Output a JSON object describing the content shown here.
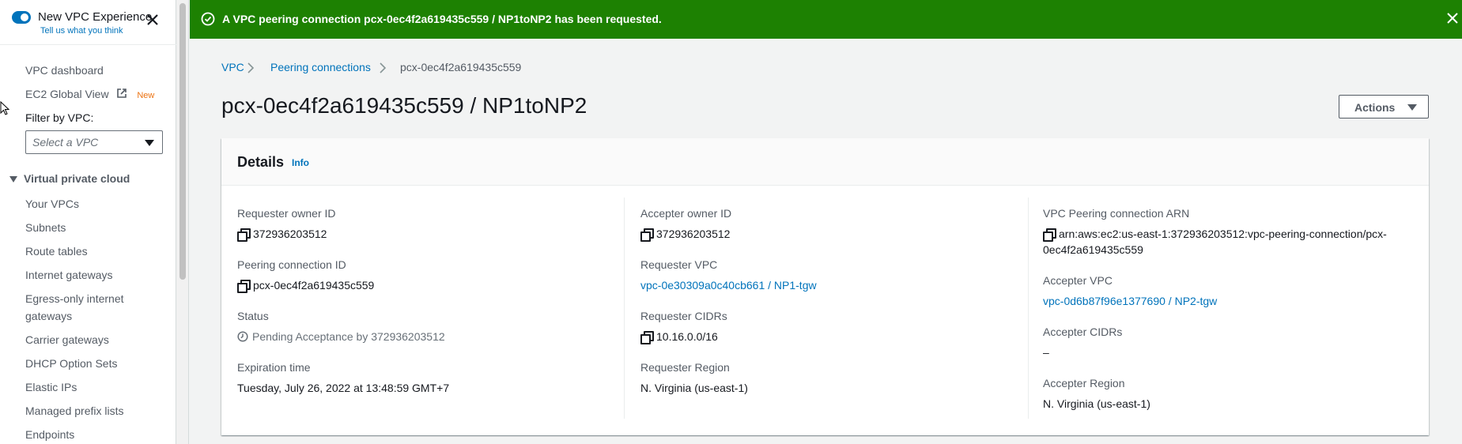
{
  "sidebar": {
    "experience_label": "New VPC Experience",
    "feedback_link": "Tell us what you think",
    "dashboard": "VPC dashboard",
    "ec2_global_view": "EC2 Global View",
    "new_badge": "New",
    "filter_label": "Filter by VPC:",
    "filter_placeholder": "Select a VPC",
    "section_title": "Virtual private cloud",
    "items": [
      {
        "label": "Your VPCs"
      },
      {
        "label": "Subnets"
      },
      {
        "label": "Route tables"
      },
      {
        "label": "Internet gateways"
      },
      {
        "label": "Egress-only internet gateways"
      },
      {
        "label": "Carrier gateways"
      },
      {
        "label": "DHCP Option Sets"
      },
      {
        "label": "Elastic IPs"
      },
      {
        "label": "Managed prefix lists"
      },
      {
        "label": "Endpoints"
      }
    ]
  },
  "flash": {
    "message": "A VPC peering connection pcx-0ec4f2a619435c559 / NP1toNP2 has been requested.",
    "color": "#1d8102"
  },
  "breadcrumb": {
    "items": [
      {
        "label": "VPC"
      },
      {
        "label": "Peering connections"
      },
      {
        "label": "pcx-0ec4f2a619435c559"
      }
    ]
  },
  "page": {
    "title": "pcx-0ec4f2a619435c559 / NP1toNP2",
    "actions_label": "Actions"
  },
  "details": {
    "title": "Details",
    "info_label": "Info",
    "requester_owner_id": {
      "label": "Requester owner ID",
      "value": "372936203512"
    },
    "peering_connection_id": {
      "label": "Peering connection ID",
      "value": "pcx-0ec4f2a619435c559"
    },
    "status": {
      "label": "Status",
      "value": "Pending Acceptance by 372936203512"
    },
    "expiration_time": {
      "label": "Expiration time",
      "value": "Tuesday, July 26, 2022 at 13:48:59 GMT+7"
    },
    "accepter_owner_id": {
      "label": "Accepter owner ID",
      "value": "372936203512"
    },
    "requester_vpc": {
      "label": "Requester VPC",
      "value": "vpc-0e30309a0c40cb661 / NP1-tgw"
    },
    "requester_cidrs": {
      "label": "Requester CIDRs",
      "value": "10.16.0.0/16"
    },
    "requester_region": {
      "label": "Requester Region",
      "value": "N. Virginia (us-east-1)"
    },
    "peering_arn": {
      "label": "VPC Peering connection ARN",
      "value_line1": "arn:aws:ec2:us-east-1:372936203512:vpc-peering-connection/pcx-",
      "value_line2": "0ec4f2a619435c559"
    },
    "accepter_vpc": {
      "label": "Accepter VPC",
      "value": "vpc-0d6b87f96e1377690 / NP2-tgw"
    },
    "accepter_cidrs": {
      "label": "Accepter CIDRs",
      "value": "–"
    },
    "accepter_region": {
      "label": "Accepter Region",
      "value": "N. Virginia (us-east-1)"
    }
  }
}
